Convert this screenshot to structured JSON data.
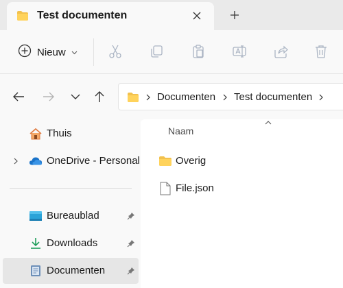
{
  "tab": {
    "title": "Test documenten",
    "folder_icon": "folder-icon",
    "close_icon": "close-icon"
  },
  "new_tab_icon": "plus-icon",
  "toolbar": {
    "new_label": "Nieuw",
    "new_icon": "plus-circle-icon",
    "new_dropdown_icon": "chevron-down-icon",
    "actions": [
      {
        "name": "cut",
        "icon": "scissors-icon"
      },
      {
        "name": "copy",
        "icon": "copy-icon"
      },
      {
        "name": "paste",
        "icon": "clipboard-icon"
      },
      {
        "name": "rename",
        "icon": "rename-icon"
      },
      {
        "name": "share",
        "icon": "share-icon"
      },
      {
        "name": "delete",
        "icon": "trash-icon"
      }
    ]
  },
  "navigation": {
    "back_icon": "arrow-left-icon",
    "forward_icon": "arrow-right-icon",
    "recent_icon": "chevron-down-icon",
    "up_icon": "arrow-up-icon"
  },
  "address": {
    "breadcrumbs": [
      "Documenten",
      "Test documenten"
    ],
    "separator_icon": "chevron-right-icon"
  },
  "sidebar": {
    "items": [
      {
        "label": "Thuis",
        "icon": "home-icon",
        "pinned": false,
        "expandable": false,
        "selected": false
      },
      {
        "label": "OneDrive - Personal",
        "icon": "cloud-icon",
        "pinned": false,
        "expandable": true,
        "selected": false
      },
      {
        "label": "Bureaublad",
        "icon": "desktop-icon",
        "pinned": true,
        "expandable": false,
        "selected": false
      },
      {
        "label": "Downloads",
        "icon": "download-icon",
        "pinned": true,
        "expandable": false,
        "selected": false
      },
      {
        "label": "Documenten",
        "icon": "document-icon",
        "pinned": true,
        "expandable": false,
        "selected": true
      }
    ]
  },
  "content": {
    "column_header": "Naam",
    "sort_icon": "chevron-up-icon",
    "files": [
      {
        "name": "Overig",
        "icon": "folder-icon"
      },
      {
        "name": "File.json",
        "icon": "file-icon"
      }
    ]
  },
  "colors": {
    "folder": "#f2c14e",
    "accent_blue": "#1a73c9",
    "download_green": "#1f9e5a",
    "home_orange": "#e07a3f"
  }
}
